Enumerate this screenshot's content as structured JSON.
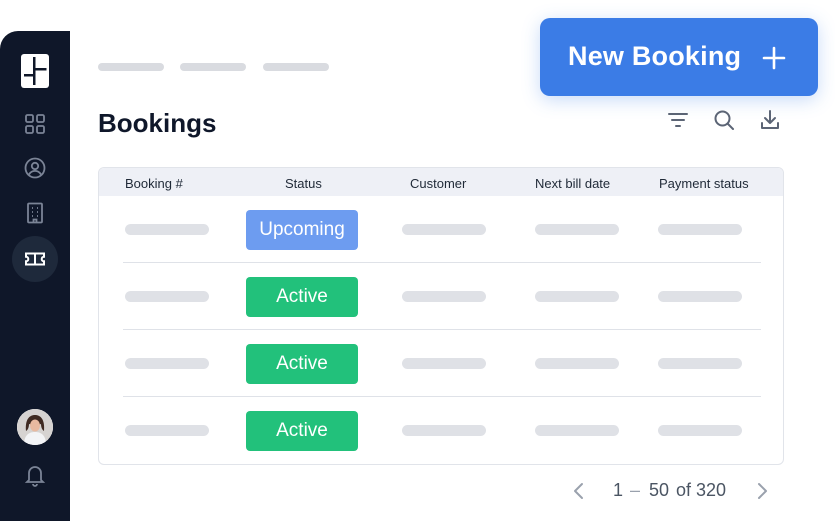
{
  "header": {
    "title": "Bookings",
    "new_booking_label": "New Booking",
    "breadcrumb_count": 3
  },
  "sidebar": {
    "items": [
      {
        "icon": "grid-icon"
      },
      {
        "icon": "user-circle-icon"
      },
      {
        "icon": "building-icon"
      },
      {
        "icon": "ticket-icon",
        "active": true
      }
    ],
    "bottom": [
      {
        "icon": "avatar"
      },
      {
        "icon": "bell-icon"
      }
    ]
  },
  "toolbar": {
    "icons": [
      "filter-icon",
      "search-icon",
      "download-icon"
    ]
  },
  "table": {
    "columns": [
      "Booking #",
      "Status",
      "Customer",
      "Next bill date",
      "Payment status"
    ],
    "rows": [
      {
        "status": "Upcoming",
        "status_color": "#6d9cf0"
      },
      {
        "status": "Active",
        "status_color": "#22c17b"
      },
      {
        "status": "Active",
        "status_color": "#22c17b"
      },
      {
        "status": "Active",
        "status_color": "#22c17b"
      }
    ]
  },
  "pagination": {
    "start": "1",
    "separator": "–",
    "end": "50",
    "of_label": "of",
    "total": "320"
  },
  "colors": {
    "sidebar": "#0f1729",
    "accent": "#3b7ce6",
    "active_badge": "#22c17b",
    "upcoming_badge": "#6d9cf0"
  }
}
